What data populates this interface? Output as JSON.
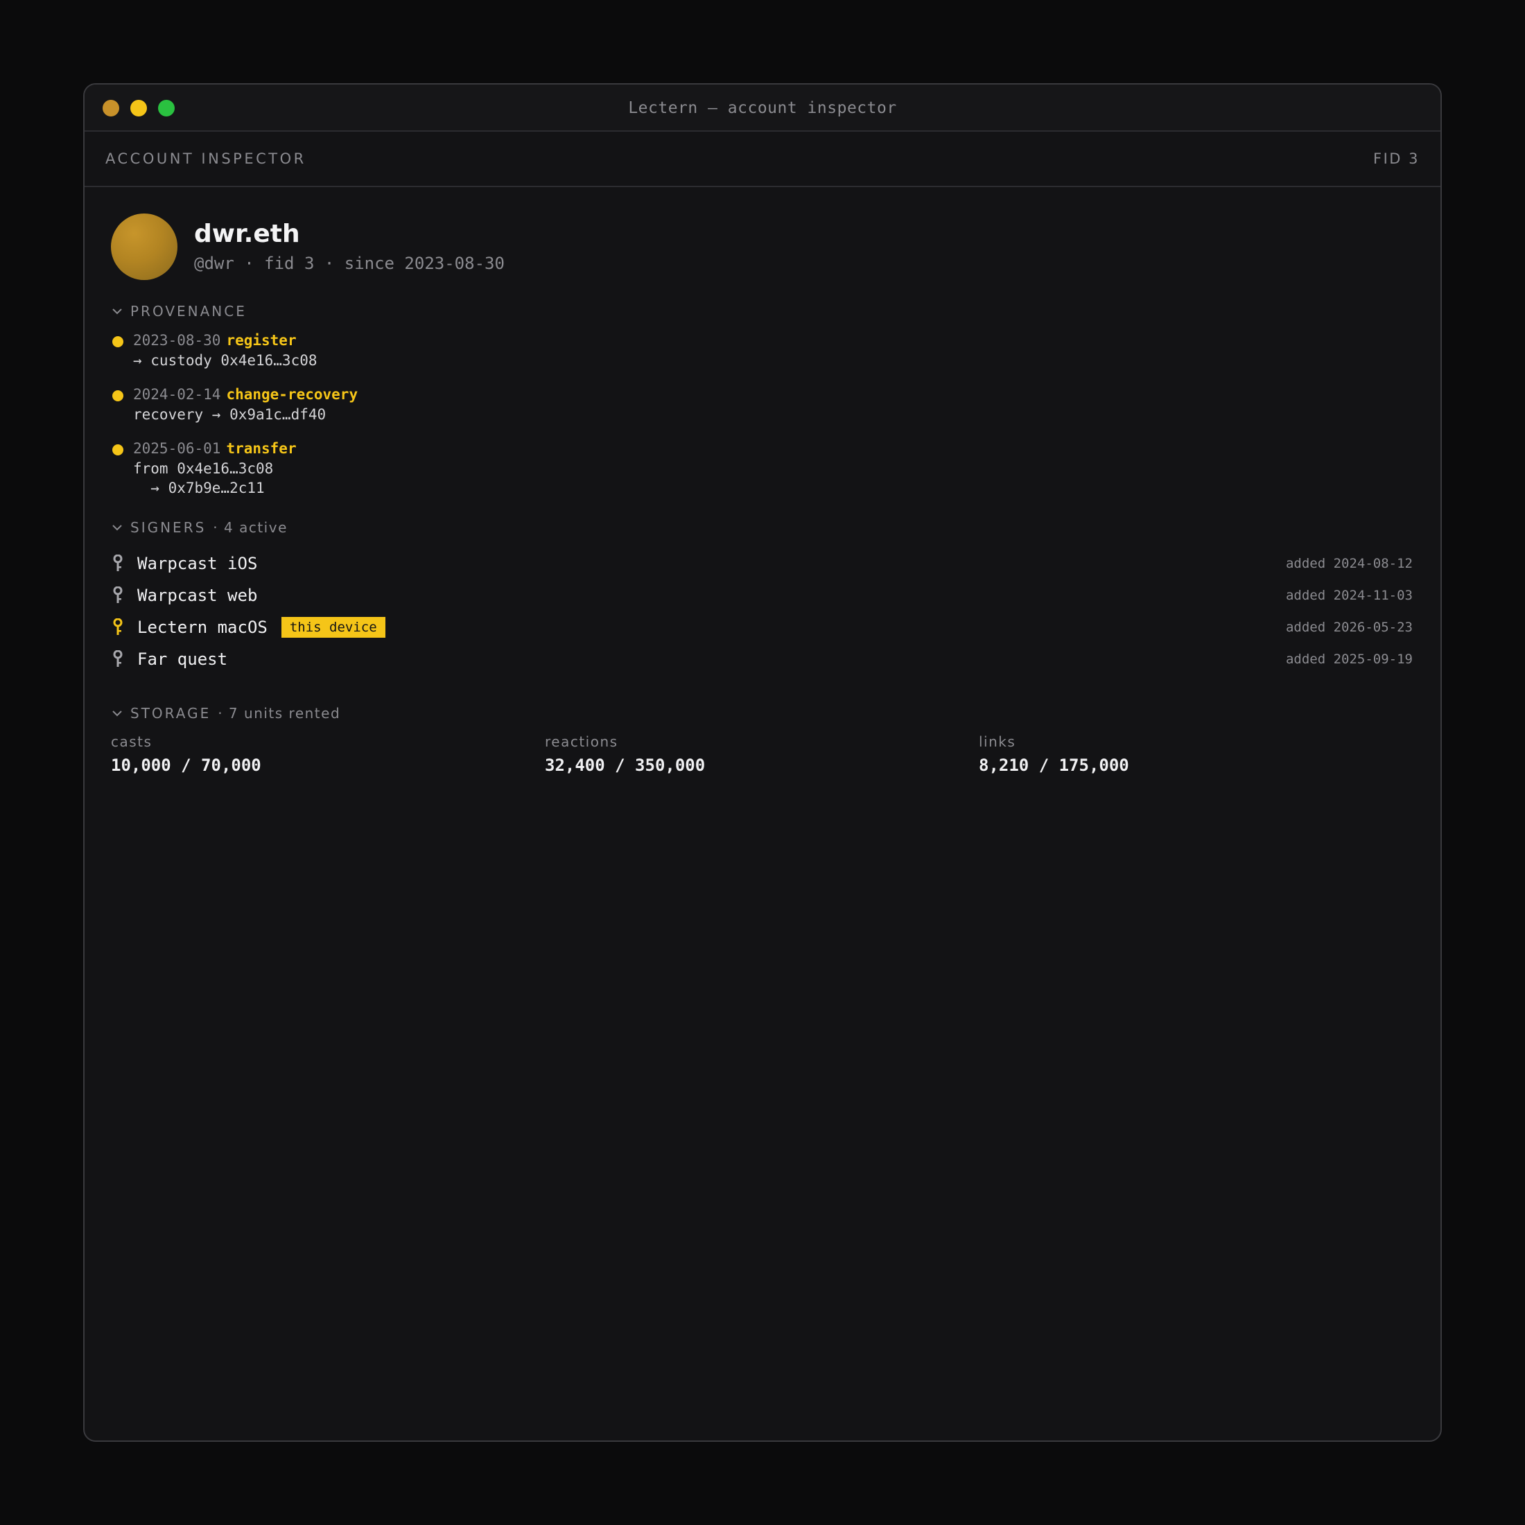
{
  "window": {
    "title": "Lectern — account inspector"
  },
  "colors": {
    "accent": "#f5c518",
    "light_close": "#c8912a",
    "light_min": "#f5c518",
    "light_max": "#2ac140"
  },
  "header": {
    "label": "ACCOUNT INSPECTOR",
    "fid": "FID 3"
  },
  "profile": {
    "display_name": "dwr.eth",
    "meta": "@dwr · fid 3 · since 2023-08-30"
  },
  "provenance": {
    "title": "PROVENANCE",
    "events": [
      {
        "date": "2023-08-30",
        "type": "register",
        "detail": "→ custody 0x4e16…3c08"
      },
      {
        "date": "2024-02-14",
        "type": "change-recovery",
        "detail": "recovery → 0x9a1c…df40"
      },
      {
        "date": "2025-06-01",
        "type": "transfer",
        "detail": "from 0x4e16…3c08",
        "detail2": "  → 0x7b9e…2c11"
      }
    ]
  },
  "signers": {
    "title": "SIGNERS",
    "subtitle": "· 4 active",
    "items": [
      {
        "name": "Warpcast iOS",
        "added": "added 2024-08-12"
      },
      {
        "name": "Warpcast web",
        "added": "added 2024-11-03"
      },
      {
        "name": "Lectern macOS",
        "badge": "this device",
        "added": "added 2026-05-23"
      },
      {
        "name": "Far quest",
        "added": "added 2025-09-19"
      }
    ]
  },
  "storage": {
    "title": "STORAGE",
    "subtitle": "· 7 units rented",
    "items": [
      {
        "label": "casts",
        "value": "10,000 / 70,000"
      },
      {
        "label": "reactions",
        "value": "32,400 / 350,000"
      },
      {
        "label": "links",
        "value": "8,210 / 175,000"
      }
    ]
  }
}
